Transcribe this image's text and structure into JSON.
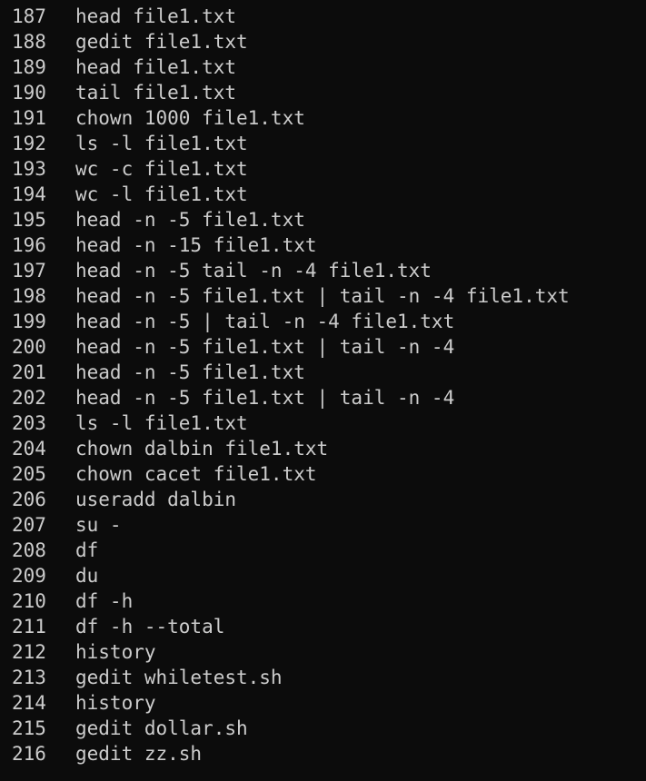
{
  "terminal": {
    "history": [
      {
        "num": "187",
        "cmd": "head file1.txt"
      },
      {
        "num": "188",
        "cmd": "gedit file1.txt"
      },
      {
        "num": "189",
        "cmd": "head file1.txt"
      },
      {
        "num": "190",
        "cmd": "tail file1.txt"
      },
      {
        "num": "191",
        "cmd": "chown 1000 file1.txt"
      },
      {
        "num": "192",
        "cmd": "ls -l file1.txt"
      },
      {
        "num": "193",
        "cmd": "wc -c file1.txt"
      },
      {
        "num": "194",
        "cmd": "wc -l file1.txt"
      },
      {
        "num": "195",
        "cmd": "head -n -5 file1.txt"
      },
      {
        "num": "196",
        "cmd": "head -n -15 file1.txt"
      },
      {
        "num": "197",
        "cmd": "head -n -5 tail -n -4 file1.txt"
      },
      {
        "num": "198",
        "cmd": "head -n -5 file1.txt | tail -n -4 file1.txt"
      },
      {
        "num": "199",
        "cmd": "head -n -5 | tail -n -4 file1.txt"
      },
      {
        "num": "200",
        "cmd": "head -n -5 file1.txt | tail -n -4"
      },
      {
        "num": "201",
        "cmd": "head -n -5 file1.txt"
      },
      {
        "num": "202",
        "cmd": "head -n -5 file1.txt | tail -n -4"
      },
      {
        "num": "203",
        "cmd": "ls -l file1.txt"
      },
      {
        "num": "204",
        "cmd": "chown dalbin file1.txt"
      },
      {
        "num": "205",
        "cmd": "chown cacet file1.txt"
      },
      {
        "num": "206",
        "cmd": "useradd dalbin"
      },
      {
        "num": "207",
        "cmd": "su -"
      },
      {
        "num": "208",
        "cmd": "df"
      },
      {
        "num": "209",
        "cmd": "du"
      },
      {
        "num": "210",
        "cmd": "df -h"
      },
      {
        "num": "211",
        "cmd": "df -h --total"
      },
      {
        "num": "212",
        "cmd": "history"
      },
      {
        "num": "213",
        "cmd": "gedit whiletest.sh"
      },
      {
        "num": "214",
        "cmd": "history"
      },
      {
        "num": "215",
        "cmd": "gedit dollar.sh"
      },
      {
        "num": "216",
        "cmd": "gedit zz.sh"
      }
    ]
  },
  "colors": {
    "background": "#0c0c0c",
    "text": "#cccccc"
  }
}
